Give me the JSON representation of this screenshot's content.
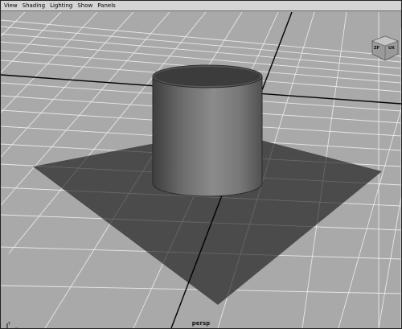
{
  "menu": {
    "items": [
      "View",
      "Shading",
      "Lighting",
      "Show",
      "Panels"
    ]
  },
  "viewport": {
    "camera_label": "persp",
    "view_cube": {
      "left": "ZF",
      "right": "UX"
    },
    "axis": {
      "y": "Y",
      "x": "X",
      "z": "Z"
    }
  },
  "colors": {
    "menu_bg": "#d4d4d4",
    "viewport_bg": "#a9a9a9",
    "grid_line": "#e6e6e6",
    "grid_axis": "#000000",
    "plane": "#4d4d4d",
    "cylinder_dark": "#3a3a3a",
    "cylinder_light": "#9a9a9a"
  },
  "icons": [
    "view-cube-icon",
    "axis-gizmo-icon"
  ]
}
